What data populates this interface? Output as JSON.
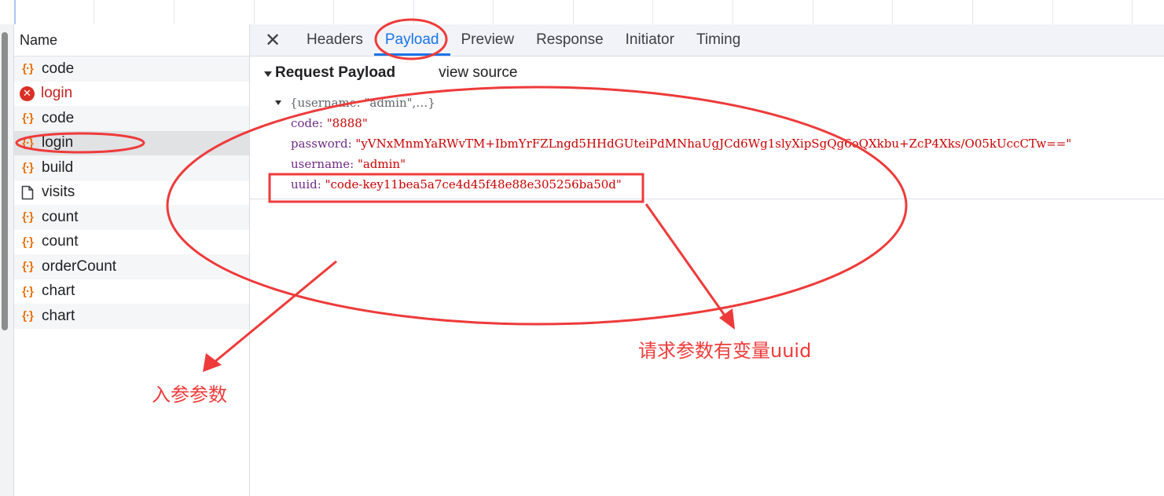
{
  "requests": {
    "header": "Name",
    "items": [
      {
        "name": "code",
        "icon": "fetch-icon"
      },
      {
        "name": "login",
        "icon": "error-icon",
        "status": "error"
      },
      {
        "name": "code",
        "icon": "fetch-icon"
      },
      {
        "name": "login",
        "icon": "fetch-icon",
        "status": "selected"
      },
      {
        "name": "build",
        "icon": "fetch-icon"
      },
      {
        "name": "visits",
        "icon": "document-icon"
      },
      {
        "name": "count",
        "icon": "fetch-icon"
      },
      {
        "name": "count",
        "icon": "fetch-icon"
      },
      {
        "name": "orderCount",
        "icon": "fetch-icon"
      },
      {
        "name": "chart",
        "icon": "fetch-icon"
      },
      {
        "name": "chart",
        "icon": "fetch-icon"
      }
    ]
  },
  "tabs": {
    "close_icon": "close-icon",
    "items": [
      "Headers",
      "Payload",
      "Preview",
      "Response",
      "Initiator",
      "Timing"
    ],
    "active": "Payload"
  },
  "payload": {
    "section_title": "Request Payload",
    "view_source": "view source",
    "summary": "{username: \"admin\",…}",
    "props": [
      {
        "key": "code",
        "value": "\"8888\""
      },
      {
        "key": "password",
        "value": "\"yVNxMnmYaRWvTM+IbmYrFZLngd5HHdGUteiPdMNhaUgJCd6Wg1slyXipSgQg6oQXkbu+ZcP4Xks/O05kUccCTw==\""
      },
      {
        "key": "username",
        "value": "\"admin\""
      },
      {
        "key": "uuid",
        "value": "\"code-key11bea5a7ce4d45f48e88e305256ba50d\""
      }
    ]
  },
  "annotations": {
    "left_note": "入参参数",
    "right_note": "请求参数有变量uuid",
    "color": "#ee3a3a"
  },
  "colors": {
    "accent": "#1a73e8",
    "error": "#d93025",
    "fetch_icon": "#e8710a",
    "json_key": "#6e2b86",
    "json_string": "#c80000"
  }
}
